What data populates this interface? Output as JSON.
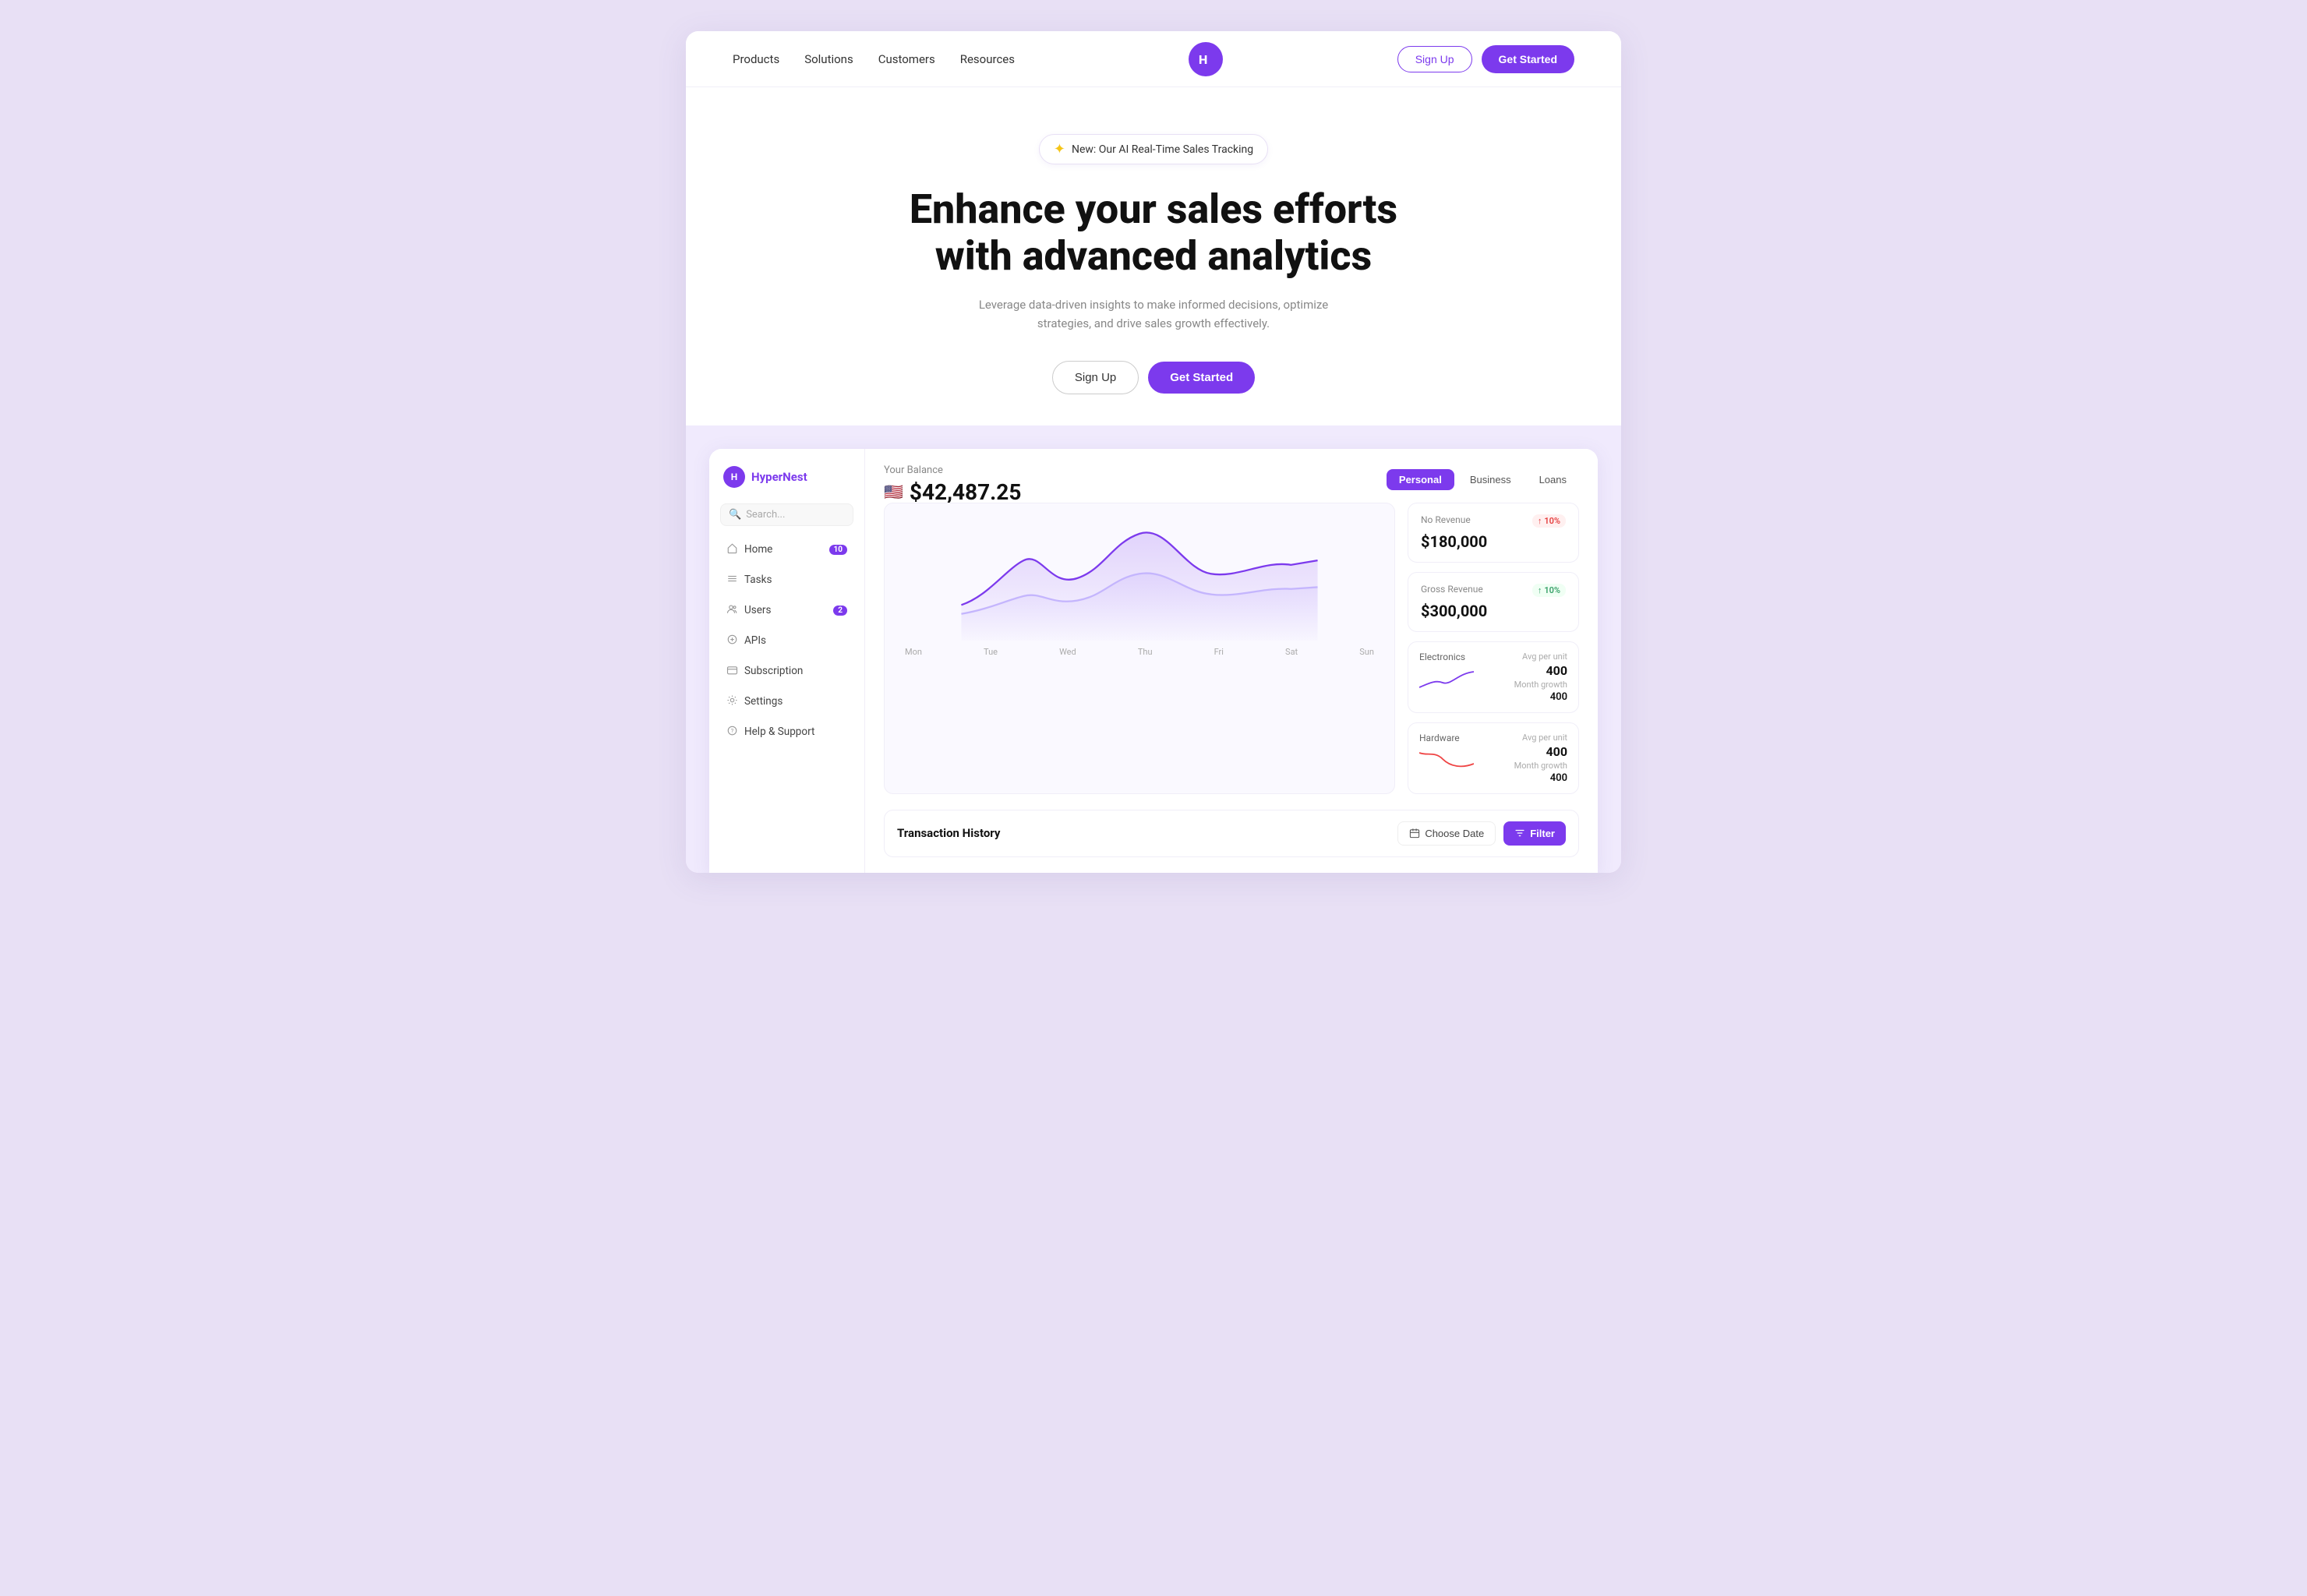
{
  "page": {
    "bg_color": "#e8e0f5"
  },
  "navbar": {
    "links": [
      {
        "label": "Products",
        "id": "products"
      },
      {
        "label": "Solutions",
        "id": "solutions"
      },
      {
        "label": "Customers",
        "id": "customers"
      },
      {
        "label": "Resources",
        "id": "resources"
      }
    ],
    "logo_text": "H",
    "signup_label": "Sign Up",
    "get_started_label": "Get Started"
  },
  "hero": {
    "badge_icon": "✦",
    "badge_text": "New: Our AI Real-Time Sales Tracking",
    "title_line1": "Enhance your sales efforts",
    "title_line2": "with advanced analytics",
    "subtitle": "Leverage data-driven insights to make informed decisions, optimize strategies, and drive sales growth effectively.",
    "signup_label": "Sign Up",
    "get_started_label": "Get Started"
  },
  "dashboard": {
    "sidebar": {
      "logo_text": "HyperNest",
      "logo_icon": "H",
      "search_placeholder": "Search...",
      "items": [
        {
          "label": "Home",
          "badge": "10",
          "icon": "🏠"
        },
        {
          "label": "Tasks",
          "badge": null,
          "icon": "☰"
        },
        {
          "label": "Users",
          "badge": "2",
          "icon": "👥"
        },
        {
          "label": "APIs",
          "badge": null,
          "icon": "⚙"
        },
        {
          "label": "Subscription",
          "badge": null,
          "icon": "💳"
        },
        {
          "label": "Settings",
          "badge": null,
          "icon": "⚙"
        },
        {
          "label": "Help & Support",
          "badge": null,
          "icon": "❓"
        }
      ]
    },
    "balance": {
      "label": "Your Balance",
      "flag": "🇺🇸",
      "amount": "$42,487.25"
    },
    "tabs": [
      {
        "label": "Personal",
        "active": true
      },
      {
        "label": "Business",
        "active": false
      },
      {
        "label": "Loans",
        "active": false
      }
    ],
    "chart": {
      "x_labels": [
        "Mon",
        "Tue",
        "Wed",
        "Thu",
        "Fri",
        "Sat",
        "Sun"
      ]
    },
    "stats": [
      {
        "label": "No Revenue",
        "value": "$180,000",
        "badge_type": "red",
        "badge_text": "10%"
      },
      {
        "label": "Gross Revenue",
        "value": "$300,000",
        "badge_type": "green",
        "badge_text": "10%"
      }
    ],
    "sub_stats": [
      {
        "name": "Electronics",
        "avg_label": "Avg per unit",
        "avg_value": "400",
        "growth_label": "Month growth",
        "growth_value": "400",
        "trend": "up"
      },
      {
        "name": "Hardware",
        "avg_label": "Avg per unit",
        "avg_value": "400",
        "growth_label": "Month growth",
        "growth_value": "400",
        "trend": "down"
      }
    ],
    "transaction_history": {
      "title": "Transaction History",
      "choose_date_label": "Choose Date",
      "filter_label": "Filter"
    }
  }
}
